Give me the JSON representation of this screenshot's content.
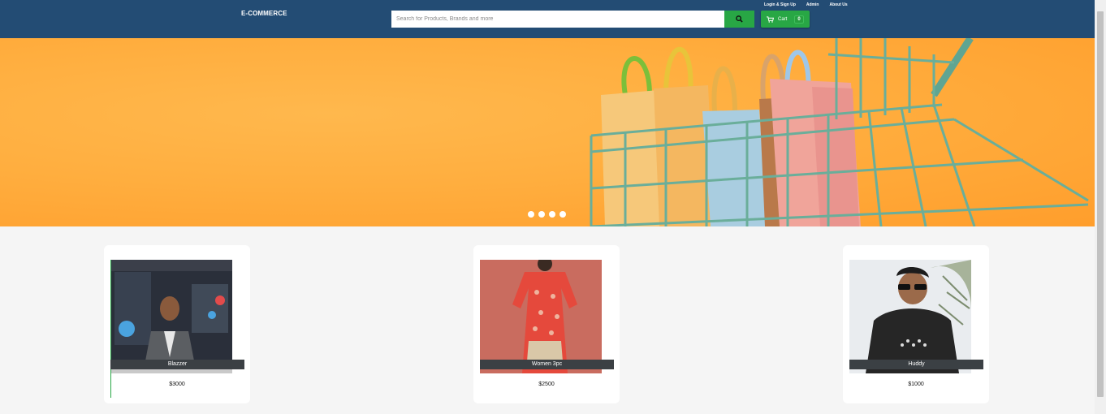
{
  "header": {
    "brand": "E-COMMERCE",
    "search_placeholder": "Search for Products, Brands and more",
    "cart_label": "Cart",
    "cart_count": "0",
    "links": [
      "Login & Sign Up",
      "Admin",
      "About Us"
    ]
  },
  "banner": {
    "slide_count": 4,
    "active_slide": 0
  },
  "products": [
    {
      "name": "Blazzer",
      "price": "$3000"
    },
    {
      "name": "Women 3pc",
      "price": "$2500"
    },
    {
      "name": "Huddy",
      "price": "$1000"
    }
  ],
  "colors": {
    "navbar": "#234c74",
    "accent": "#28a745",
    "banner": "#ffae3f"
  }
}
